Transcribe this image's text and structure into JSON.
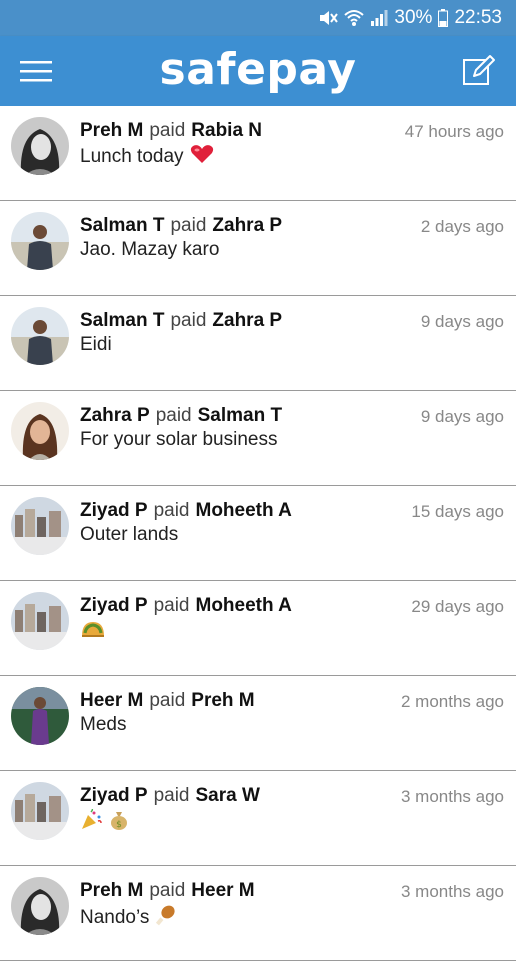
{
  "status_bar": {
    "battery": "30%",
    "time": "22:53",
    "icons": [
      "mute-icon",
      "wifi-icon",
      "signal-icon",
      "battery-icon"
    ]
  },
  "app_bar": {
    "title": "safepay",
    "menu_icon": "hamburger-menu-icon",
    "compose_icon": "compose-icon"
  },
  "colors": {
    "app_bar": "#3d8fd2",
    "status_bar": "#4a90c9",
    "divider": "#9a9a9a",
    "timestamp": "#888888"
  },
  "feed": [
    {
      "from": "Preh M",
      "verb": "paid",
      "to": "Rabia N",
      "time": "47 hours ago",
      "note": "Lunch today",
      "emoji": "heart-emoji",
      "avatar": "avatar-woman-bw"
    },
    {
      "from": "Salman T",
      "verb": "paid",
      "to": "Zahra P",
      "time": "2 days ago",
      "note": "Jao. Mazay karo",
      "emoji": "",
      "avatar": "avatar-man-outdoor"
    },
    {
      "from": "Salman T",
      "verb": "paid",
      "to": "Zahra P",
      "time": "9 days ago",
      "note": "Eidi",
      "emoji": "",
      "avatar": "avatar-man-outdoor"
    },
    {
      "from": "Zahra P",
      "verb": "paid",
      "to": "Salman T",
      "time": "9 days ago",
      "note": "For your solar business",
      "emoji": "",
      "avatar": "avatar-woman-smiling"
    },
    {
      "from": "Ziyad P",
      "verb": "paid",
      "to": "Moheeth A",
      "time": "15 days ago",
      "note": "Outer lands",
      "emoji": "",
      "avatar": "avatar-cityscape"
    },
    {
      "from": "Ziyad P",
      "verb": "paid",
      "to": "Moheeth A",
      "time": "29 days ago",
      "note": "",
      "emoji": "taco-emoji",
      "avatar": "avatar-cityscape"
    },
    {
      "from": "Heer M",
      "verb": "paid",
      "to": "Preh M",
      "time": "2 months ago",
      "note": "Meds",
      "emoji": "",
      "avatar": "avatar-woman-purple"
    },
    {
      "from": "Ziyad P",
      "verb": "paid",
      "to": "Sara W",
      "time": "3 months ago",
      "note": "",
      "emoji": "party-popper-emoji money-bag-emoji",
      "avatar": "avatar-cityscape"
    },
    {
      "from": "Preh M",
      "verb": "paid",
      "to": "Heer M",
      "time": "3 months ago",
      "note": "Nando’s",
      "emoji": "chicken-leg-emoji",
      "avatar": "avatar-woman-bw"
    }
  ]
}
